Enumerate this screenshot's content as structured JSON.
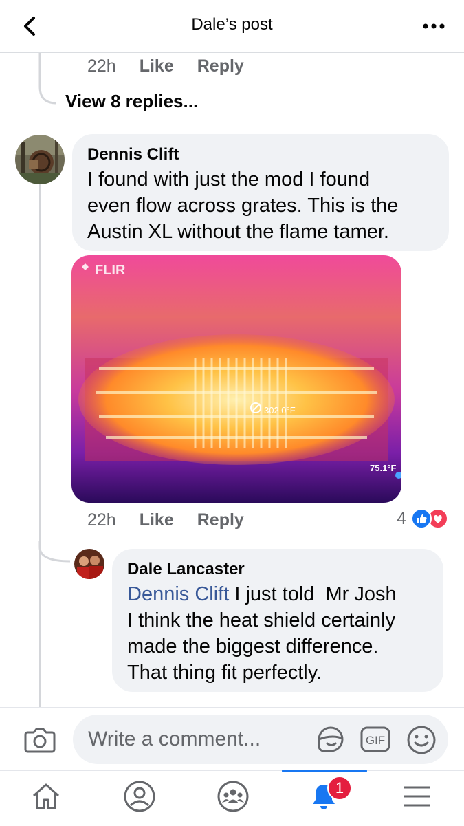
{
  "header": {
    "title": "Dale’s post"
  },
  "prev_comment": {
    "time": "22h",
    "like": "Like",
    "reply": "Reply"
  },
  "view_replies": "View 8 replies...",
  "comment": {
    "author": "Dennis Clift",
    "text_lines": [
      "I found with just the mod I found",
      "even flow across grates. This is the",
      "Austin XL without the flame tamer."
    ],
    "image": {
      "brand": "FLIR",
      "center_temp": "302.0°F",
      "corner_temp": "75.1°F"
    },
    "time": "22h",
    "like": "Like",
    "reply": "Reply",
    "reaction_count": "4",
    "reactions": [
      "like",
      "love"
    ]
  },
  "reply": {
    "author": "Dale Lancaster",
    "mention": "Dennis Clift",
    "first_line_rest": " I just told  Mr Josh",
    "text_lines": [
      "I think the heat shield certainly",
      "made the biggest difference.",
      "That thing fit perfectly."
    ]
  },
  "composer": {
    "placeholder": "Write a comment..."
  },
  "nav": {
    "notification_badge": "1"
  },
  "colors": {
    "accent": "#1877f2",
    "badge": "#e41e3f",
    "link": "#385898"
  }
}
